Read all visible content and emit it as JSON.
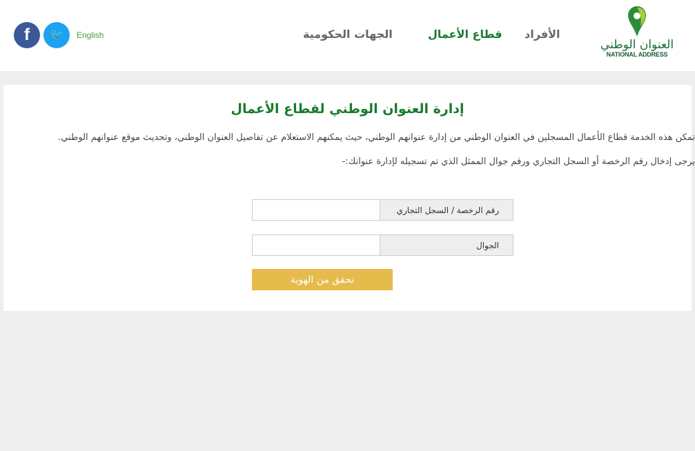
{
  "header": {
    "logo_ar": "العنوان الوطني",
    "logo_en": "NATIONAL ADDRESS",
    "nav": [
      "الأفراد",
      "قطاع الأعمال",
      "الجهات الحكومية"
    ],
    "language": "English",
    "social": {
      "twitter": "twitter-icon",
      "facebook": "facebook-icon"
    },
    "accent": "#1a7a2e"
  },
  "main": {
    "title": "إدارة العنوان الوطني لقطاع الأعمال",
    "description": "تمكن هذه الخدمة قطاع الأعمال المسجلين في العنوان الوطني من إدارة عنوانهم الوطني، حيث يمكنهم الاستعلام عن تفاصيل العنوان الوطني، وتحديث موقع عنوانهم الوطني.",
    "instruction": "يرجى إدخال رقم الرخصة أو السجل التجاري ورقم جوال الممثل الذي تم تسجيله لإدارة عنوانك:-",
    "license_label": "رقم الرخصة / السجل التجاري",
    "license_value": "",
    "mobile_label": "الجوال",
    "mobile_value": "",
    "verify_button": "تحقق من الهوية",
    "button_color": "#e5bb4c"
  }
}
